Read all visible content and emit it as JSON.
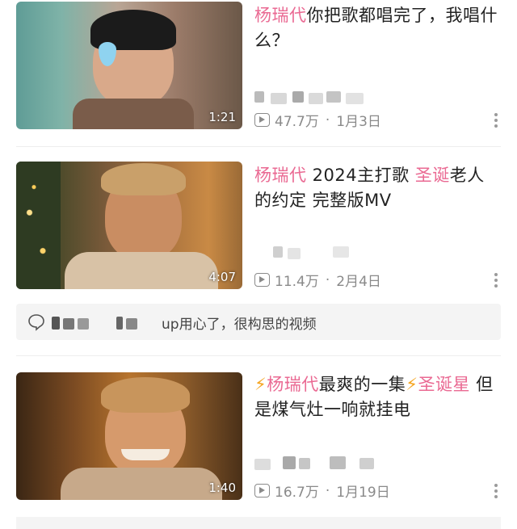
{
  "videos": [
    {
      "title_parts": [
        {
          "text": "杨瑞代",
          "hl": true
        },
        {
          "text": "你把歌都唱完了，我唱什么？",
          "hl": false
        }
      ],
      "duration": "1:21",
      "views": "47.7万",
      "date": "1月3日"
    },
    {
      "title_parts": [
        {
          "text": "杨瑞代",
          "hl": true
        },
        {
          "text": " 2024主打歌 ",
          "hl": false
        },
        {
          "text": "圣诞",
          "hl": true
        },
        {
          "text": "老人的约定 完整版MV",
          "hl": false
        }
      ],
      "duration": "4:07",
      "views": "11.4万",
      "date": "2月4日"
    },
    {
      "title_parts": [
        {
          "text": "⚡",
          "hl": false,
          "bolt": true
        },
        {
          "text": "杨瑞代",
          "hl": true
        },
        {
          "text": "最爽的一集",
          "hl": false
        },
        {
          "text": "⚡",
          "hl": false,
          "bolt": true
        },
        {
          "text": "圣诞星",
          "hl": true
        },
        {
          "text": " 但是煤气灶一响就挂电",
          "hl": false
        }
      ],
      "duration": "1:40",
      "views": "16.7万",
      "date": "1月19日"
    }
  ],
  "comment": {
    "text": "up用心了，很构思的视频"
  },
  "meta": {
    "separator": "·"
  },
  "colors": {
    "highlight": "#ea6a93",
    "meta_gray": "#8a8a8a"
  }
}
